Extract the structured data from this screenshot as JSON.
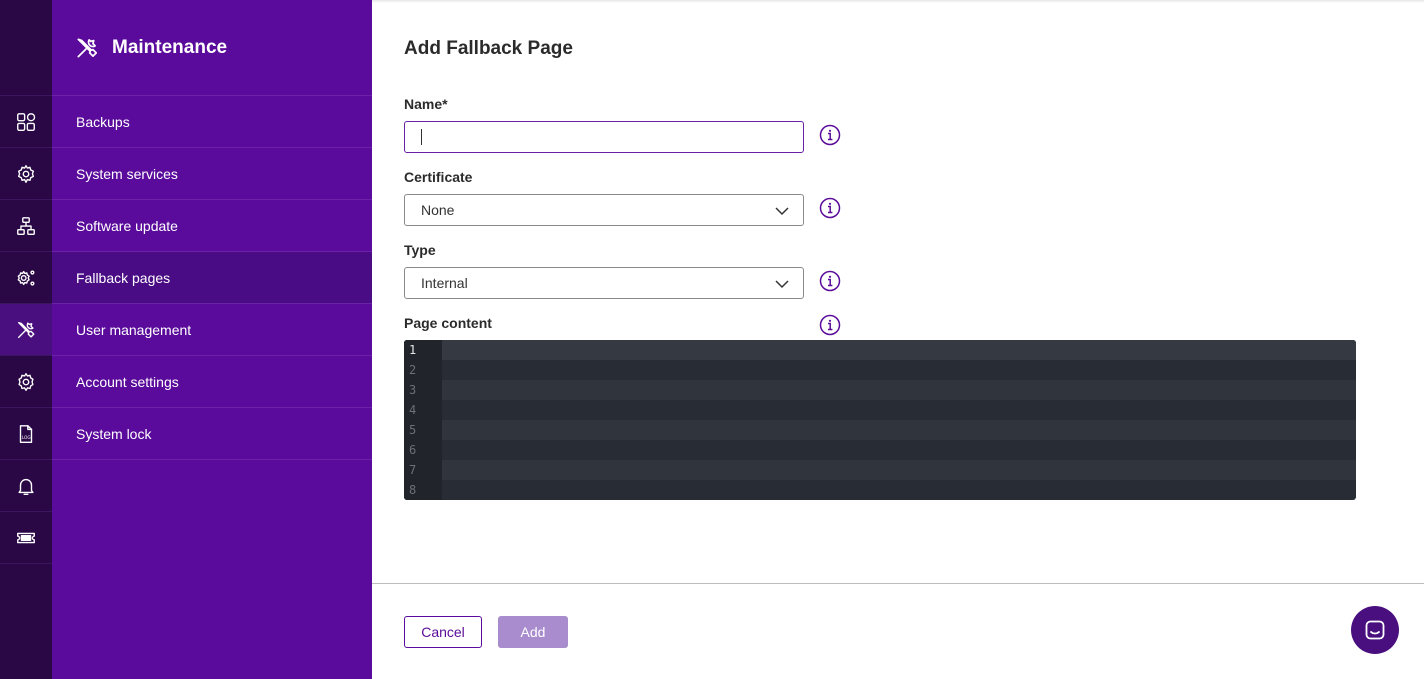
{
  "sidebar": {
    "title": "Maintenance",
    "items": [
      {
        "label": "Backups"
      },
      {
        "label": "System services"
      },
      {
        "label": "Software update"
      },
      {
        "label": "Fallback pages"
      },
      {
        "label": "User management"
      },
      {
        "label": "Account settings"
      },
      {
        "label": "System lock"
      }
    ],
    "active_item": "Fallback pages"
  },
  "rail": {
    "icons": [
      "grid-icon",
      "settings-cluster-icon",
      "network-icon",
      "gear-share-icon",
      "tools-icon",
      "gear-icon",
      "log-file-icon",
      "bell-icon",
      "ticket-icon"
    ],
    "log_label": "LOG",
    "active_icon": "tools-icon"
  },
  "form": {
    "title": "Add Fallback Page",
    "name_label": "Name*",
    "name_value": "",
    "certificate_label": "Certificate",
    "certificate_value": "None",
    "type_label": "Type",
    "type_value": "Internal",
    "page_content_label": "Page content",
    "line_numbers": [
      "1",
      "2",
      "3",
      "4",
      "5",
      "6",
      "7",
      "8"
    ]
  },
  "footer": {
    "cancel_label": "Cancel",
    "add_label": "Add"
  },
  "colors": {
    "rail_bg": "#2a0845",
    "sidebar_bg": "#5a0b9b",
    "accent": "#5a0b9b",
    "add_button_disabled": "#a98ccd",
    "editor_bg": "#282c34"
  }
}
